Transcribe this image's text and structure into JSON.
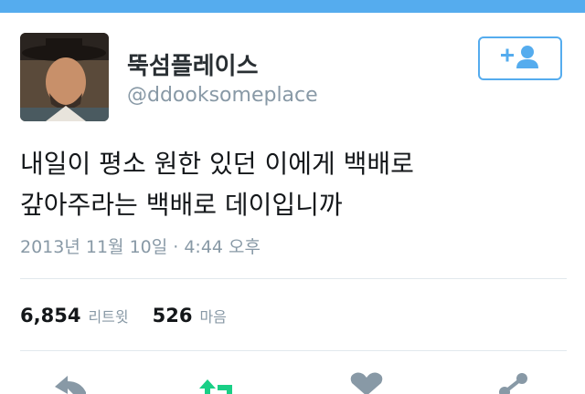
{
  "profile": {
    "display_name": "뚝섬플레이스",
    "handle": "@ddooksomeplace"
  },
  "follow_button": {
    "icon": "add-user-icon",
    "color": "#55acee"
  },
  "tweet": {
    "lines": [
      "내일이 평소 원한 있던 이에게 백배로",
      "갚아주라는 백배로 데이입니까"
    ],
    "timestamp": "2013년 11월 10일 · 4:44 오후"
  },
  "stats": {
    "retweets_count": "6,854",
    "retweets_label": "리트윗",
    "likes_count": "526",
    "likes_label": "마음"
  },
  "actions": [
    {
      "name": "reply-icon",
      "color": "#8899a6"
    },
    {
      "name": "retweet-icon",
      "color": "#19cf86"
    },
    {
      "name": "heart-icon",
      "color": "#8899a6"
    },
    {
      "name": "share-icon",
      "color": "#8899a6"
    }
  ],
  "colors": {
    "accent": "#55acee",
    "top_bar": "#55acee",
    "secondary_text": "#8899a6"
  }
}
